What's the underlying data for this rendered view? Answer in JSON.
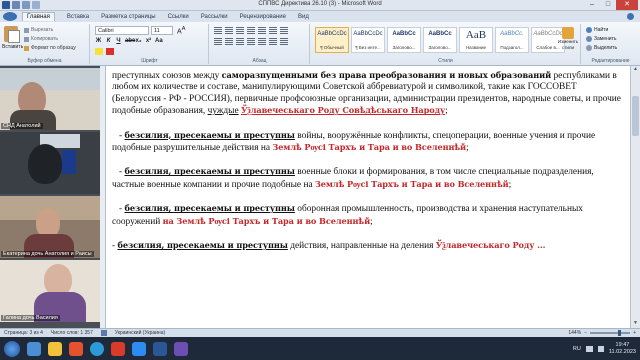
{
  "window": {
    "title": "СППВС Директива 26.10 (3) - Microsoft Word"
  },
  "ribbon_tabs": [
    "Главная",
    "Вставка",
    "Разметка страницы",
    "Ссылки",
    "Рассылки",
    "Рецензирование",
    "Вид"
  ],
  "clipboard": {
    "paste": "Вставить",
    "cut": "Вырезать",
    "copy": "Копировать",
    "format_painter": "Формат по образцу",
    "group": "Буфер обмена"
  },
  "font": {
    "name": "Calibri",
    "size": "11",
    "group": "Шрифт"
  },
  "paragraph": {
    "group": "Абзац"
  },
  "styles": {
    "items": [
      {
        "sample": "AaBbCcDc",
        "name": "¶ Обычный"
      },
      {
        "sample": "AaBbCcDc",
        "name": "¶ Без инте..."
      },
      {
        "sample": "AaBbCc",
        "name": "Заголово..."
      },
      {
        "sample": "AaBbCc",
        "name": "Заголово..."
      },
      {
        "sample": "AaB",
        "name": "Название"
      },
      {
        "sample": "AaBbCc.",
        "name": "Подзагол..."
      },
      {
        "sample": "AaBbCcDc",
        "name": "Слабое в..."
      }
    ],
    "change_styles": "Изменить стили",
    "group": "Стили"
  },
  "editing": {
    "find": "Найти",
    "replace": "Заменить",
    "select": "Выделить",
    "group": "Редактирование"
  },
  "participants": [
    {
      "name": "СНД Анатолий"
    },
    {
      "name": ""
    },
    {
      "name": "Екатерина дочь Анатолия и Раисы"
    },
    {
      "name": "Галина дочь Василия"
    }
  ],
  "document": {
    "p1": {
      "a": "преступных союзов между ",
      "b": "самоpазпущенными без права преобразования и новых образований",
      "c": " республиками в любом их количестве и составе, манипулирующими Советской аббревиатурой и символикой, такие как ГОССОВЕТ (Белоруссия - РФ - РОССИЯ), первичные профсоюзные организации, администрации президентов, народные советы, и прочие подобные образования, ",
      "d": "чуждые",
      "e": "Ўѯлавечеськаго Роду Совѣдѣськаго Народу",
      "f": ";"
    },
    "p2": {
      "dash": "- ",
      "a": "безсилия, пресекаемы и преступны",
      "b": " войны, вооружённые конфликты, спецоперации, военные учения и прочие подобные разрушительные действия на ",
      "c": "Землѣ Рѹсі Тархъ и Тара и во Вселеннѣй",
      "d": ";"
    },
    "p3": {
      "dash": "- ",
      "a": "безсилия, пресекаемы и преступны",
      "b": " военные блоки и формирования, в том числе специальные подразделения, частные военные компании и прочие подобные на ",
      "c": "Землѣ Рѹсі Тархъ и Тара и во Вселеннѣй",
      "d": ";"
    },
    "p4": {
      "dash": "- ",
      "a": "безсилия, пресекаемы и преступны",
      "b": " оборонная промышленность, производства и хранения наступательных сооружений ",
      "c": "на Землѣ Рѹсі Тархъ и Тара и во Вселеннѣй",
      "d": ";"
    },
    "p5": {
      "dash": "- ",
      "a": "безсилия, пресекаемы и преступны",
      "b": " действия, направленные на деления ",
      "c": "Ўѯлавечеськаго Роду ..."
    }
  },
  "status": {
    "page": "Страница: 3 из 4",
    "words": "Число слов: 1 357",
    "language": "Украинский (Украина)",
    "zoom": "144%"
  },
  "taskbar": {
    "lang": "RU",
    "time": "19:47",
    "date": "11.02.2023"
  },
  "colors": {
    "red_text": "#c3282b",
    "ribbon": "#dfe7f1",
    "taskbar": "#1e2a3a"
  }
}
